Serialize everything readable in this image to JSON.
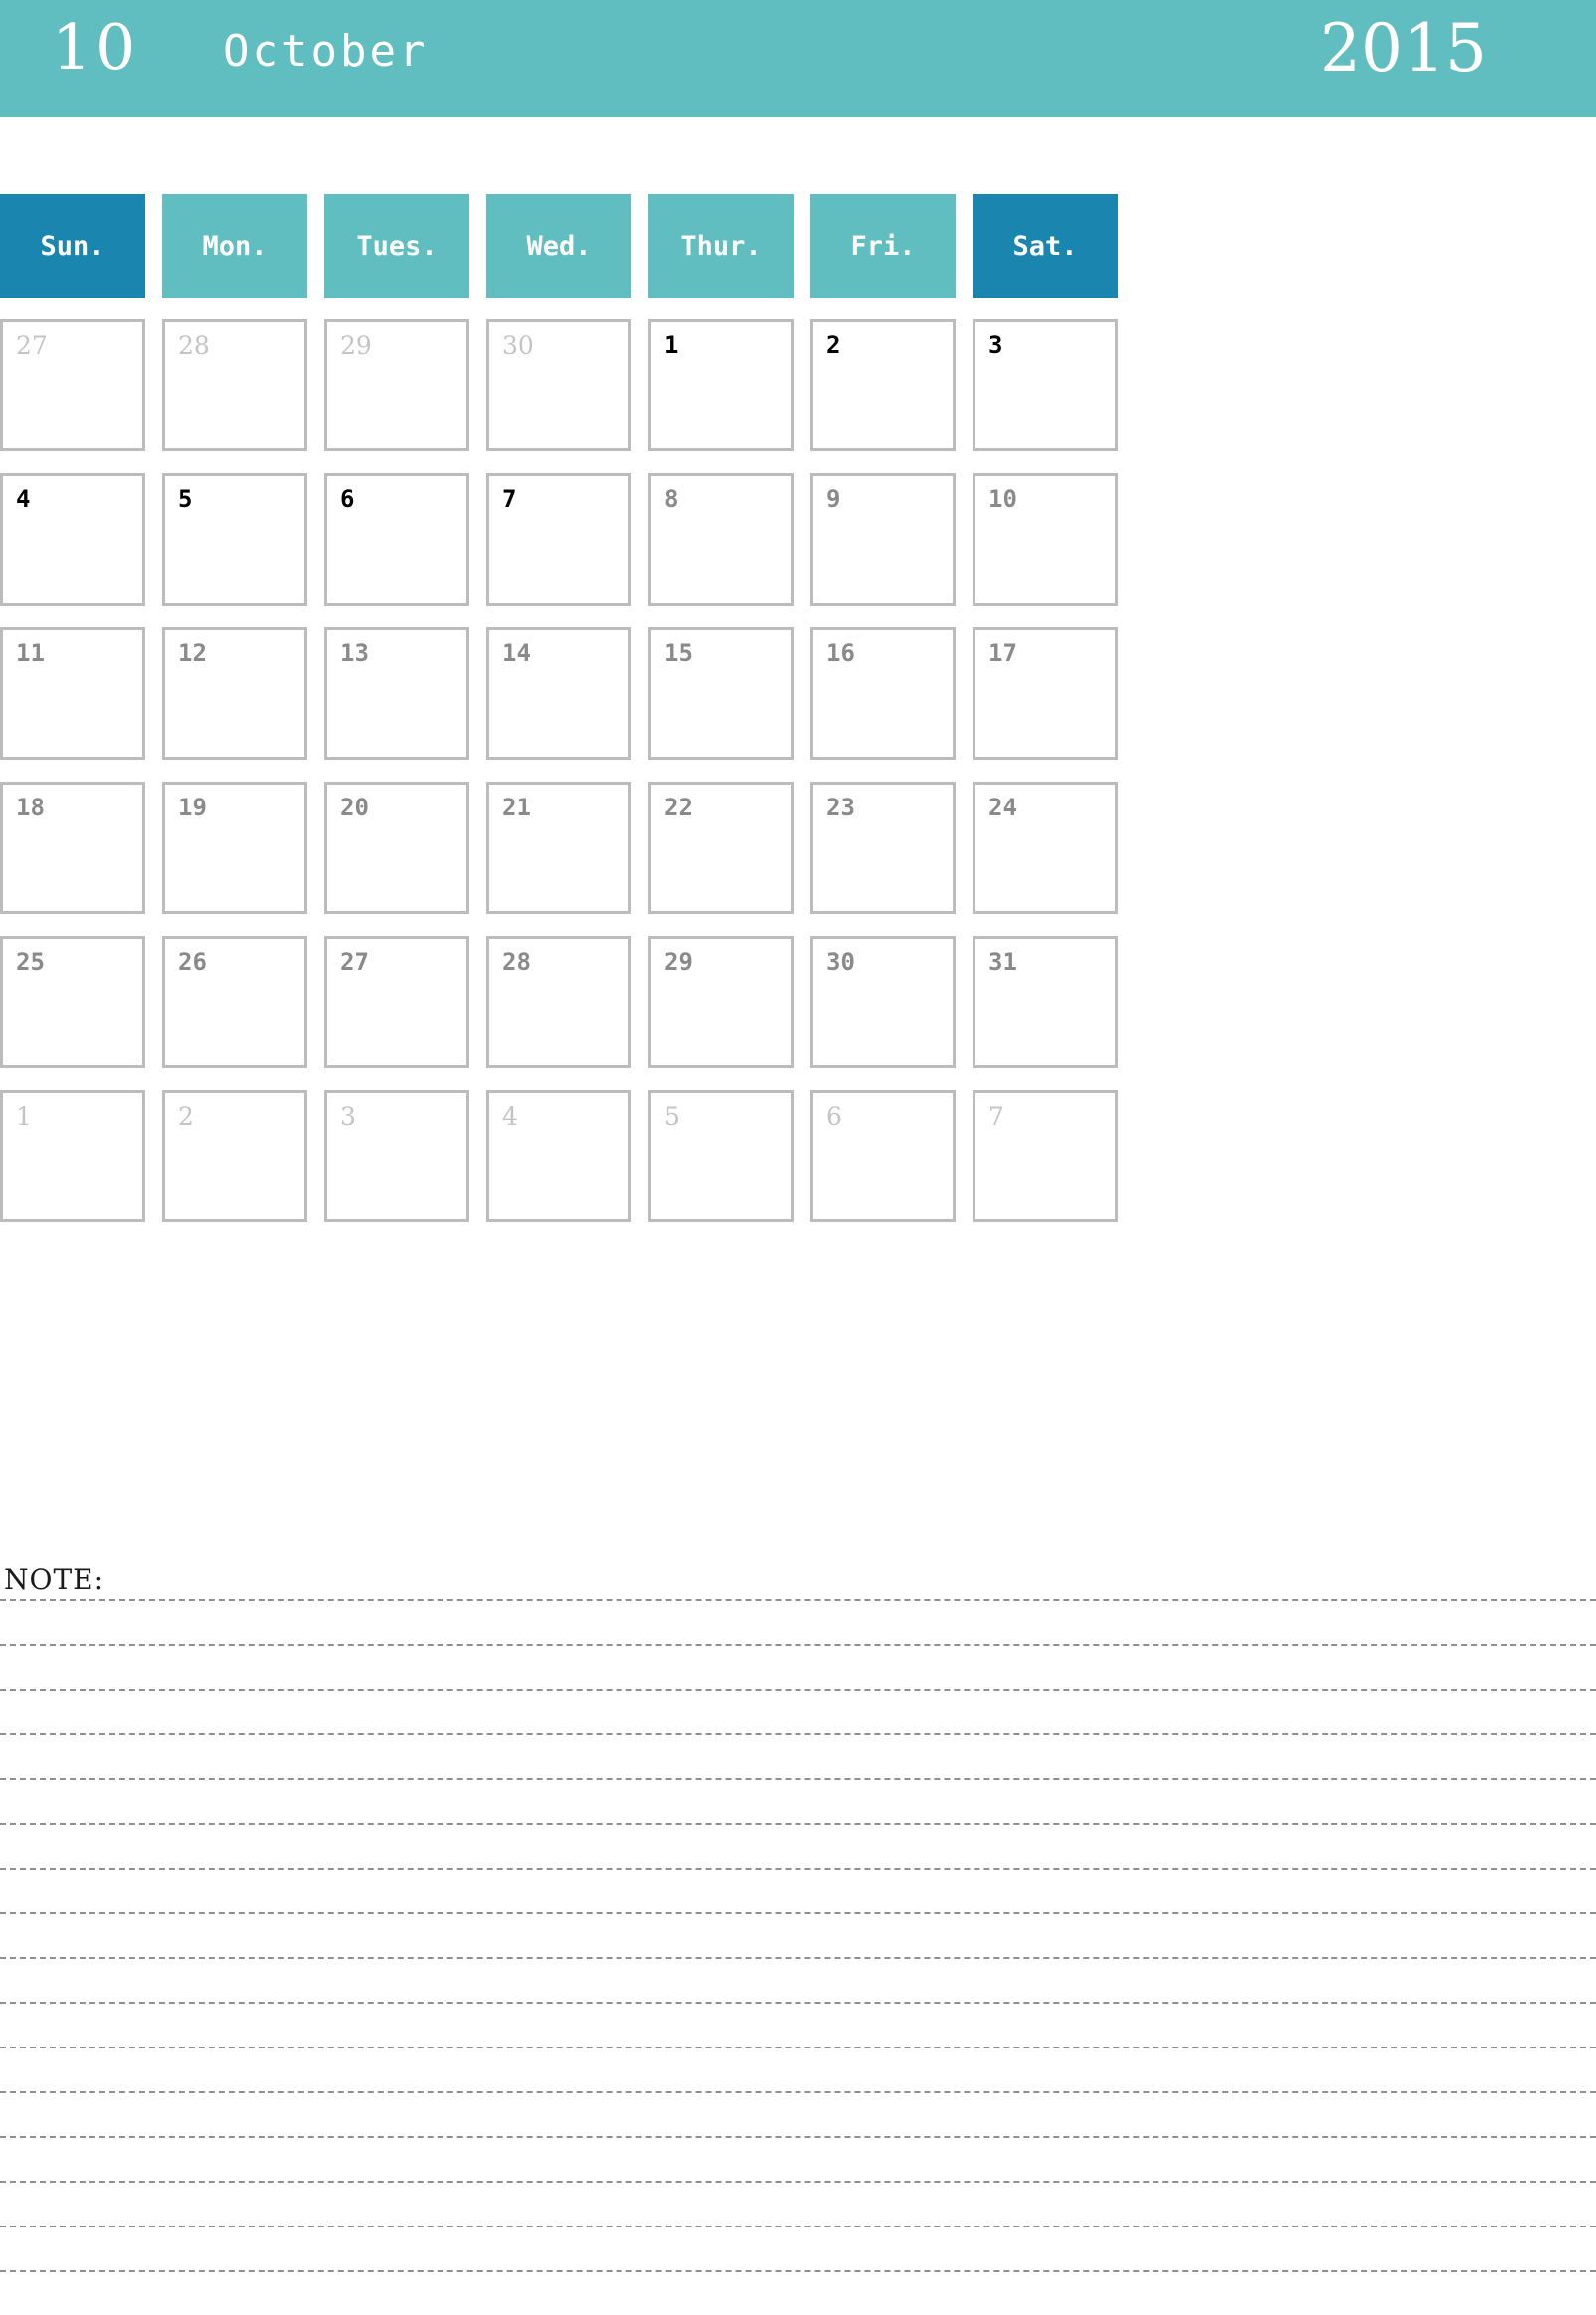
{
  "header": {
    "month_number": "10",
    "month_name": "October",
    "year": "2015"
  },
  "colors": {
    "banner_teal": "#61bec0",
    "weekday_teal": "#61bec0",
    "weekend_blue": "#1a85ae",
    "cell_border": "#bcbcbc",
    "current_day_text": "#000000",
    "muted_day_text": "#8a8a8a",
    "adjacent_day_text": "#c4c4c4",
    "note_line": "#8f8f8f"
  },
  "weekdays": [
    {
      "label": "Sun.",
      "accent": true
    },
    {
      "label": "Mon.",
      "accent": false
    },
    {
      "label": "Tues.",
      "accent": false
    },
    {
      "label": "Wed.",
      "accent": false
    },
    {
      "label": "Thur.",
      "accent": false
    },
    {
      "label": "Fri.",
      "accent": false
    },
    {
      "label": "Sat.",
      "accent": true
    }
  ],
  "weeks": [
    [
      {
        "day": "27",
        "state": "adjacent"
      },
      {
        "day": "28",
        "state": "adjacent"
      },
      {
        "day": "29",
        "state": "adjacent"
      },
      {
        "day": "30",
        "state": "adjacent"
      },
      {
        "day": "1",
        "state": "current"
      },
      {
        "day": "2",
        "state": "current"
      },
      {
        "day": "3",
        "state": "current"
      }
    ],
    [
      {
        "day": "4",
        "state": "current"
      },
      {
        "day": "5",
        "state": "current"
      },
      {
        "day": "6",
        "state": "current"
      },
      {
        "day": "7",
        "state": "current"
      },
      {
        "day": "8",
        "state": "muted"
      },
      {
        "day": "9",
        "state": "muted"
      },
      {
        "day": "10",
        "state": "muted"
      }
    ],
    [
      {
        "day": "11",
        "state": "muted"
      },
      {
        "day": "12",
        "state": "muted"
      },
      {
        "day": "13",
        "state": "muted"
      },
      {
        "day": "14",
        "state": "muted"
      },
      {
        "day": "15",
        "state": "muted"
      },
      {
        "day": "16",
        "state": "muted"
      },
      {
        "day": "17",
        "state": "muted"
      }
    ],
    [
      {
        "day": "18",
        "state": "muted"
      },
      {
        "day": "19",
        "state": "muted"
      },
      {
        "day": "20",
        "state": "muted"
      },
      {
        "day": "21",
        "state": "muted"
      },
      {
        "day": "22",
        "state": "muted"
      },
      {
        "day": "23",
        "state": "muted"
      },
      {
        "day": "24",
        "state": "muted"
      }
    ],
    [
      {
        "day": "25",
        "state": "muted"
      },
      {
        "day": "26",
        "state": "muted"
      },
      {
        "day": "27",
        "state": "muted"
      },
      {
        "day": "28",
        "state": "muted"
      },
      {
        "day": "29",
        "state": "muted"
      },
      {
        "day": "30",
        "state": "muted"
      },
      {
        "day": "31",
        "state": "muted"
      }
    ],
    [
      {
        "day": "1",
        "state": "adjacent"
      },
      {
        "day": "2",
        "state": "adjacent"
      },
      {
        "day": "3",
        "state": "adjacent"
      },
      {
        "day": "4",
        "state": "adjacent"
      },
      {
        "day": "5",
        "state": "adjacent"
      },
      {
        "day": "6",
        "state": "adjacent"
      },
      {
        "day": "7",
        "state": "adjacent"
      }
    ]
  ],
  "note": {
    "label": "NOTE:",
    "line_count": 16
  }
}
